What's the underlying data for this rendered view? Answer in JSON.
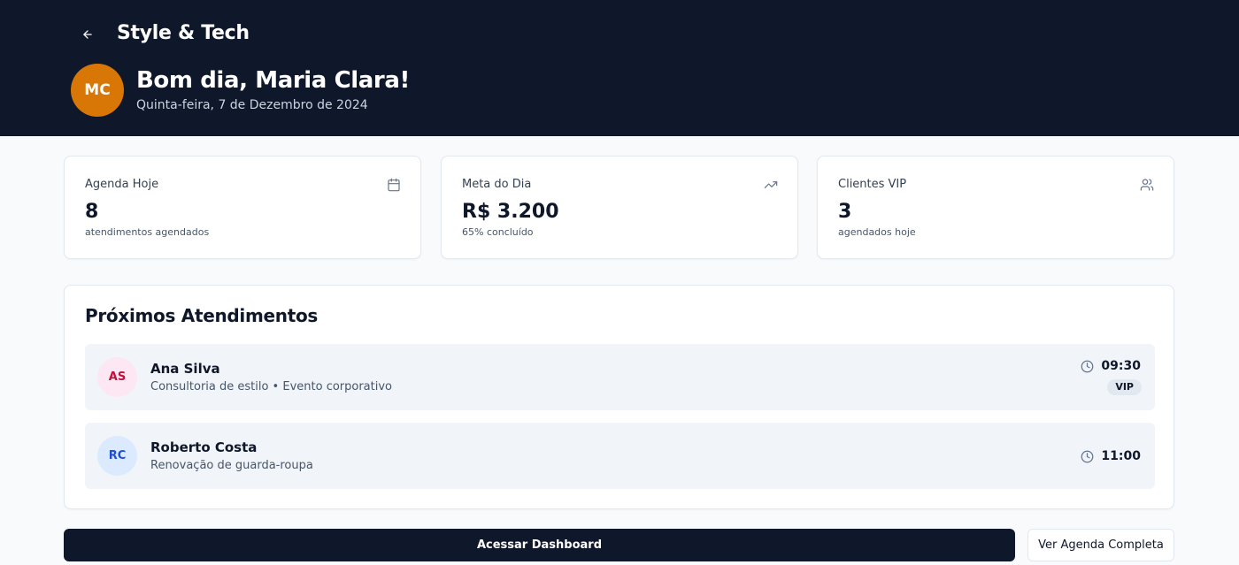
{
  "header": {
    "brand": "Style & Tech",
    "avatar_initials": "MC",
    "greeting": "Bom dia, Maria Clara!",
    "date": "Quinta-feira, 7 de Dezembro de 2024",
    "back_icon": "arrow-left-icon"
  },
  "stats": [
    {
      "title": "Agenda Hoje",
      "value": "8",
      "subtitle": "atendimentos agendados",
      "icon": "calendar-icon"
    },
    {
      "title": "Meta do Dia",
      "value": "R$ 3.200",
      "subtitle": "65% concluído",
      "icon": "trending-up-icon"
    },
    {
      "title": "Clientes VIP",
      "value": "3",
      "subtitle": "agendados hoje",
      "icon": "users-icon"
    }
  ],
  "appointments": {
    "title": "Próximos Atendimentos",
    "items": [
      {
        "initials": "AS",
        "name": "Ana Silva",
        "description": "Consultoria de estilo • Evento corporativo",
        "time": "09:30",
        "badge": "VIP",
        "avatar_bg": "#fce7f3",
        "avatar_color": "#be123c"
      },
      {
        "initials": "RC",
        "name": "Roberto Costa",
        "description": "Renovação de guarda-roupa",
        "time": "11:00",
        "avatar_bg": "#dbeafe",
        "avatar_color": "#1d4ed8"
      }
    ]
  },
  "actions": {
    "primary_label": "Acessar Dashboard",
    "secondary_label": "Ver Agenda Completa"
  },
  "colors": {
    "header_bg": "#0f172a",
    "avatar_main_bg": "#d97706",
    "page_bg": "#f8fafc"
  }
}
